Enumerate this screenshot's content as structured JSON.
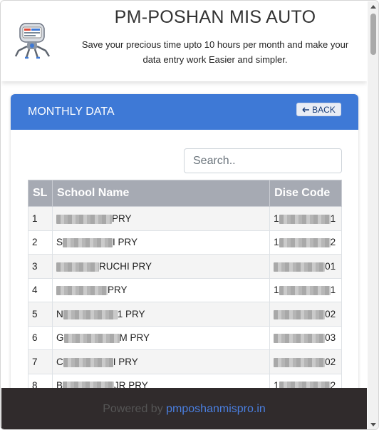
{
  "header": {
    "title": "PM-POSHAN MIS AUTO",
    "subtitle": "Save your precious time upto 10 hours per month and make your data entry work Easier and simpler.",
    "logo_icon": "robot-icon"
  },
  "card": {
    "title": "MONTHLY DATA",
    "back_label": "BACK",
    "back_icon": "arrow-left-icon",
    "accent": "#3e79d6"
  },
  "search": {
    "placeholder": "Search.."
  },
  "table": {
    "columns": [
      "SL",
      "School Name",
      "Dise Code"
    ],
    "rows": [
      {
        "sl": "1",
        "prefix": "",
        "name": "PRY",
        "code_prefix": "1",
        "code": "1"
      },
      {
        "sl": "2",
        "prefix": "S",
        "name": "I PRY",
        "code_prefix": "1",
        "code": "2"
      },
      {
        "sl": "3",
        "prefix": "",
        "name": "RUCHI PRY",
        "code_prefix": "",
        "code": "01"
      },
      {
        "sl": "4",
        "prefix": "",
        "name": "PRY",
        "code_prefix": "1",
        "code": "1"
      },
      {
        "sl": "5",
        "prefix": "N",
        "name": "1 PRY",
        "code_prefix": "",
        "code": "02"
      },
      {
        "sl": "6",
        "prefix": "G",
        "name": "M PRY",
        "code_prefix": "",
        "code": "03"
      },
      {
        "sl": "7",
        "prefix": "C",
        "name": "I PRY",
        "code_prefix": "",
        "code": "02"
      },
      {
        "sl": "8",
        "prefix": "B",
        "name": "JR PRY",
        "code_prefix": "1",
        "code": "2"
      }
    ]
  },
  "footer": {
    "prefix": "Powered by",
    "link": "pmposhanmispro.in"
  }
}
